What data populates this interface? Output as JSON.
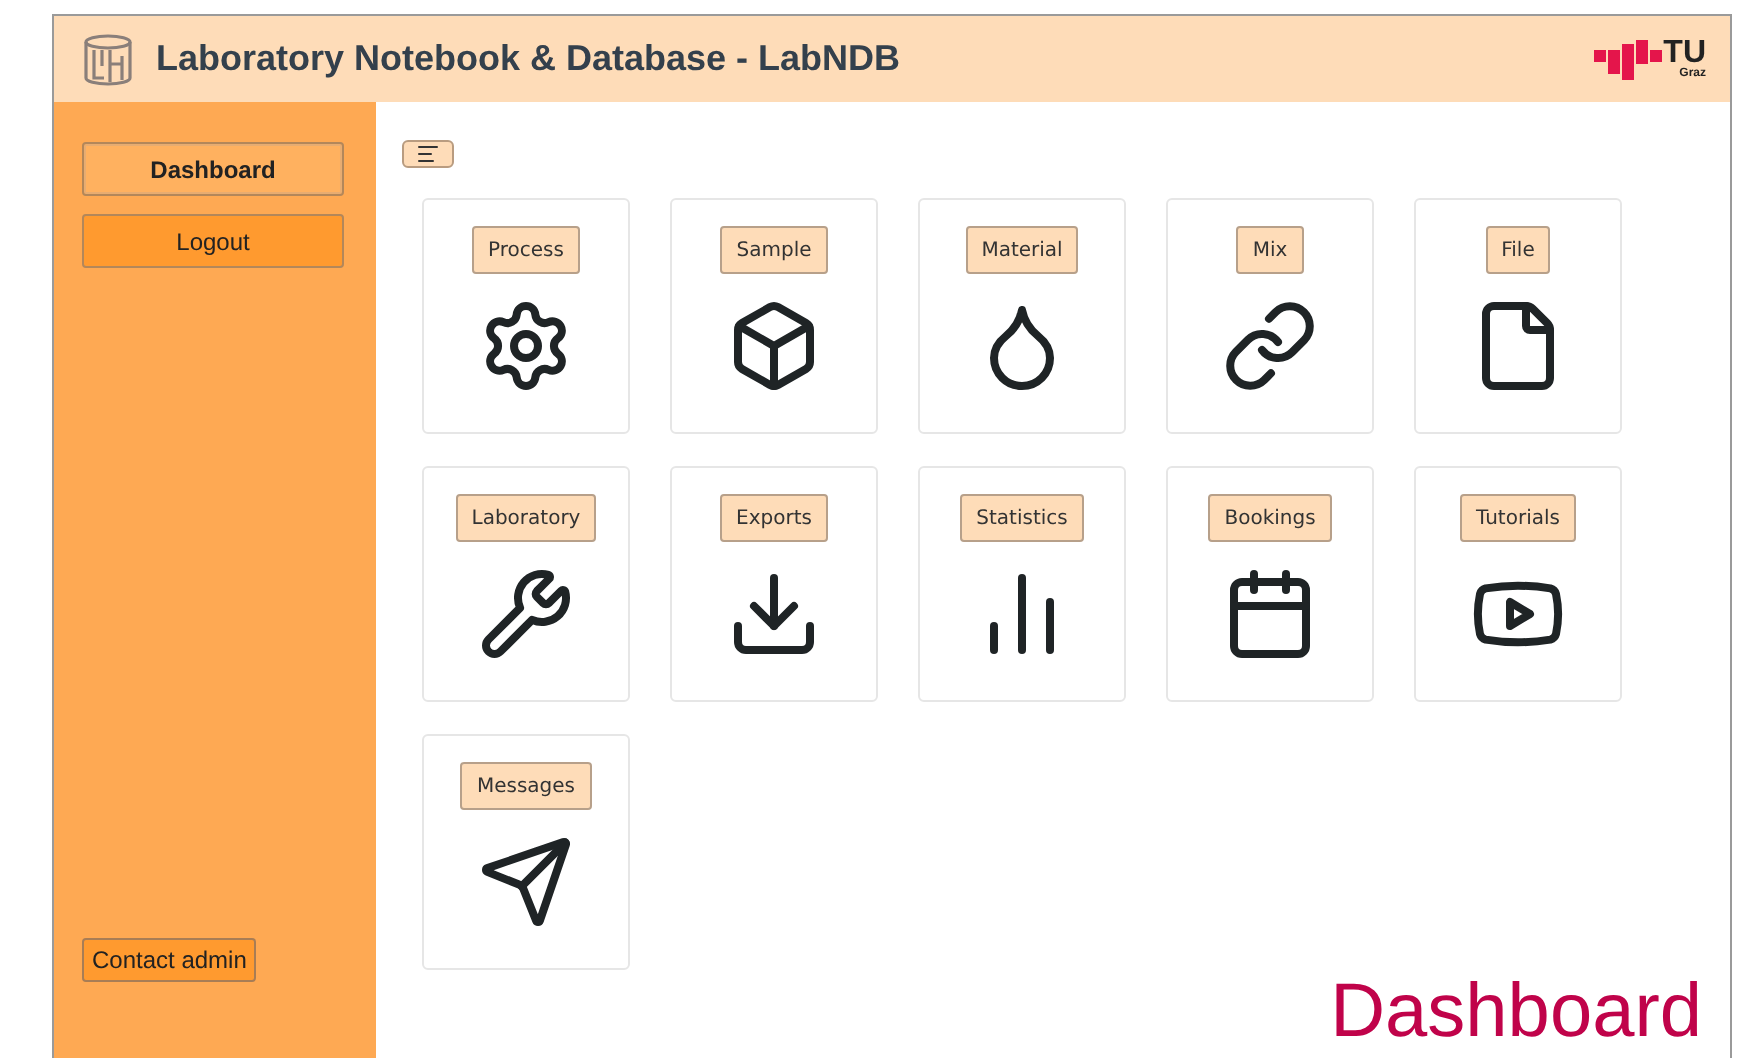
{
  "header": {
    "title": "Laboratory Notebook & Database - LabNDB",
    "logo": {
      "main": "TU",
      "sub": "Graz"
    }
  },
  "sidebar": {
    "items": [
      {
        "label": "Dashboard",
        "selected": true
      },
      {
        "label": "Logout",
        "selected": false
      }
    ],
    "contact": "Contact admin"
  },
  "tiles": [
    {
      "label": "Process",
      "kind": "gear"
    },
    {
      "label": "Sample",
      "kind": "cube"
    },
    {
      "label": "Material",
      "kind": "drop"
    },
    {
      "label": "Mix",
      "kind": "link"
    },
    {
      "label": "File",
      "kind": "file"
    },
    {
      "label": "Laboratory",
      "kind": "wrench"
    },
    {
      "label": "Exports",
      "kind": "download"
    },
    {
      "label": "Statistics",
      "kind": "bars"
    },
    {
      "label": "Bookings",
      "kind": "calendar"
    },
    {
      "label": "Tutorials",
      "kind": "video"
    },
    {
      "label": "Messages",
      "kind": "send"
    }
  ],
  "caption": "Dashboard"
}
